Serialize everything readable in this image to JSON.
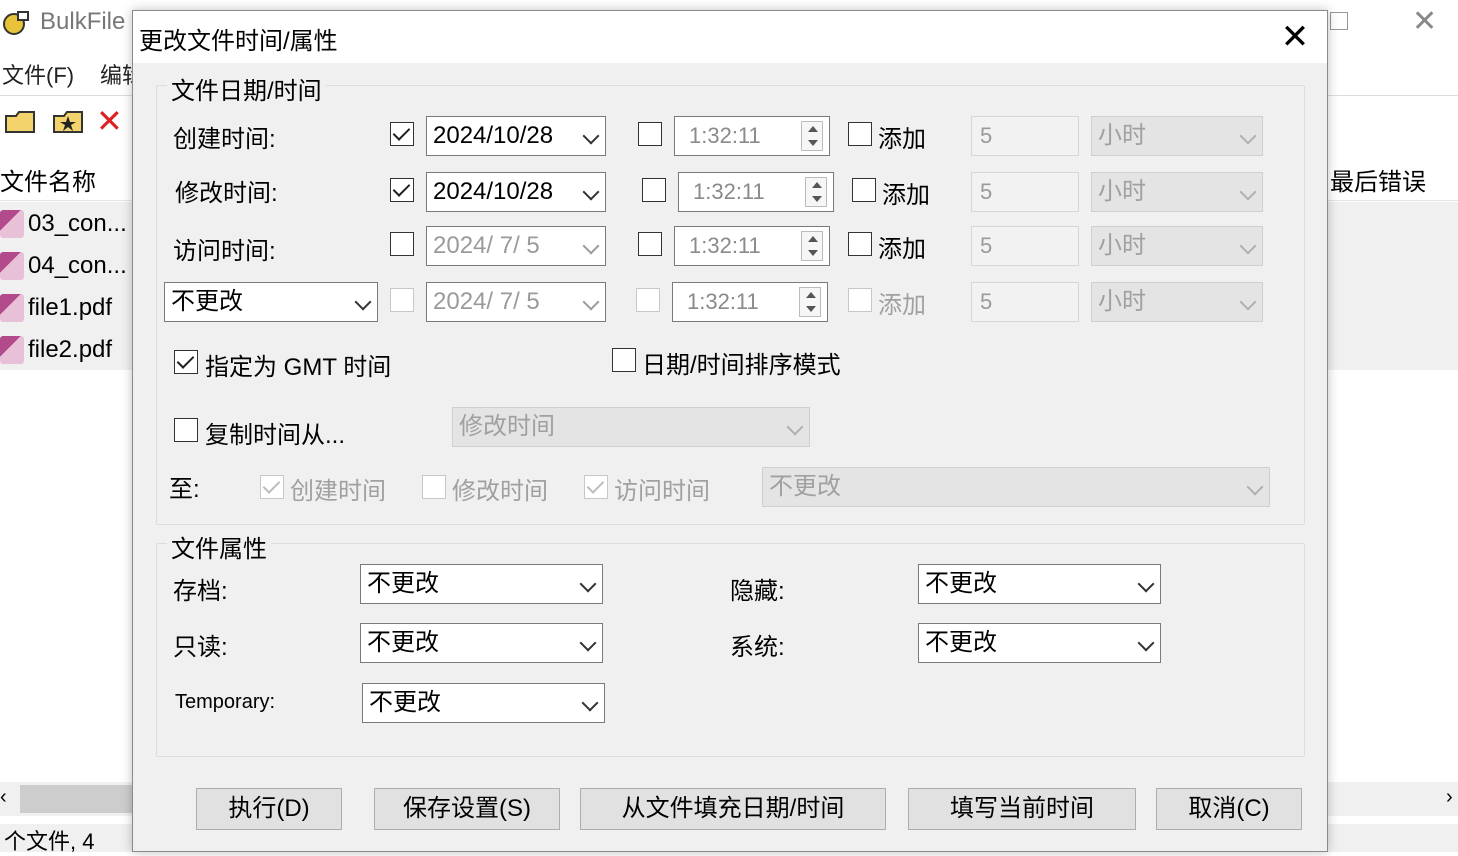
{
  "background": {
    "app_title": "BulkFile",
    "menu": [
      "文件(F)",
      "编辑"
    ],
    "columns": {
      "file_name": "文件名称",
      "last_error": "最后错误"
    },
    "files": [
      "03_con...",
      "04_con...",
      "file1.pdf",
      "file2.pdf"
    ],
    "status": "个文件, 4"
  },
  "dialog": {
    "title": "更改文件时间/属性",
    "close_glyph": "✕",
    "datetime_group": {
      "title": "文件日期/时间",
      "rows": [
        {
          "label": "创建时间:",
          "date": "2024/10/28",
          "time": "1:32:11",
          "add_label": "添加",
          "amount": "5",
          "unit": "小时"
        },
        {
          "label": "修改时间:",
          "date": "2024/10/28",
          "time": "1:32:11",
          "add_label": "添加",
          "amount": "5",
          "unit": "小时"
        },
        {
          "label": "访问时间:",
          "date": "2024/ 7/ 5",
          "time": "1:32:11",
          "add_label": "添加",
          "amount": "5",
          "unit": "小时"
        },
        {
          "label": "不更改",
          "date": "2024/ 7/ 5",
          "time": "1:32:11",
          "add_label": "添加",
          "amount": "5",
          "unit": "小时"
        }
      ],
      "gmt_label": "指定为 GMT 时间",
      "sort_mode_label": "日期/时间排序模式",
      "copy_from_label": "复制时间从...",
      "copy_from_value": "修改时间",
      "to_label": "至:",
      "to_create": "创建时间",
      "to_modify": "修改时间",
      "to_access": "访问时间",
      "to_value": "不更改"
    },
    "attr_group": {
      "title": "文件属性",
      "archive_label": "存档:",
      "archive_value": "不更改",
      "hidden_label": "隐藏:",
      "hidden_value": "不更改",
      "readonly_label": "只读:",
      "readonly_value": "不更改",
      "system_label": "系统:",
      "system_value": "不更改",
      "temporary_label": "Temporary:",
      "temporary_value": "不更改"
    },
    "buttons": {
      "execute": "执行(D)",
      "save_settings": "保存设置(S)",
      "fill_from_file": "从文件填充日期/时间",
      "fill_current": "填写当前时间",
      "cancel": "取消(C)"
    }
  }
}
